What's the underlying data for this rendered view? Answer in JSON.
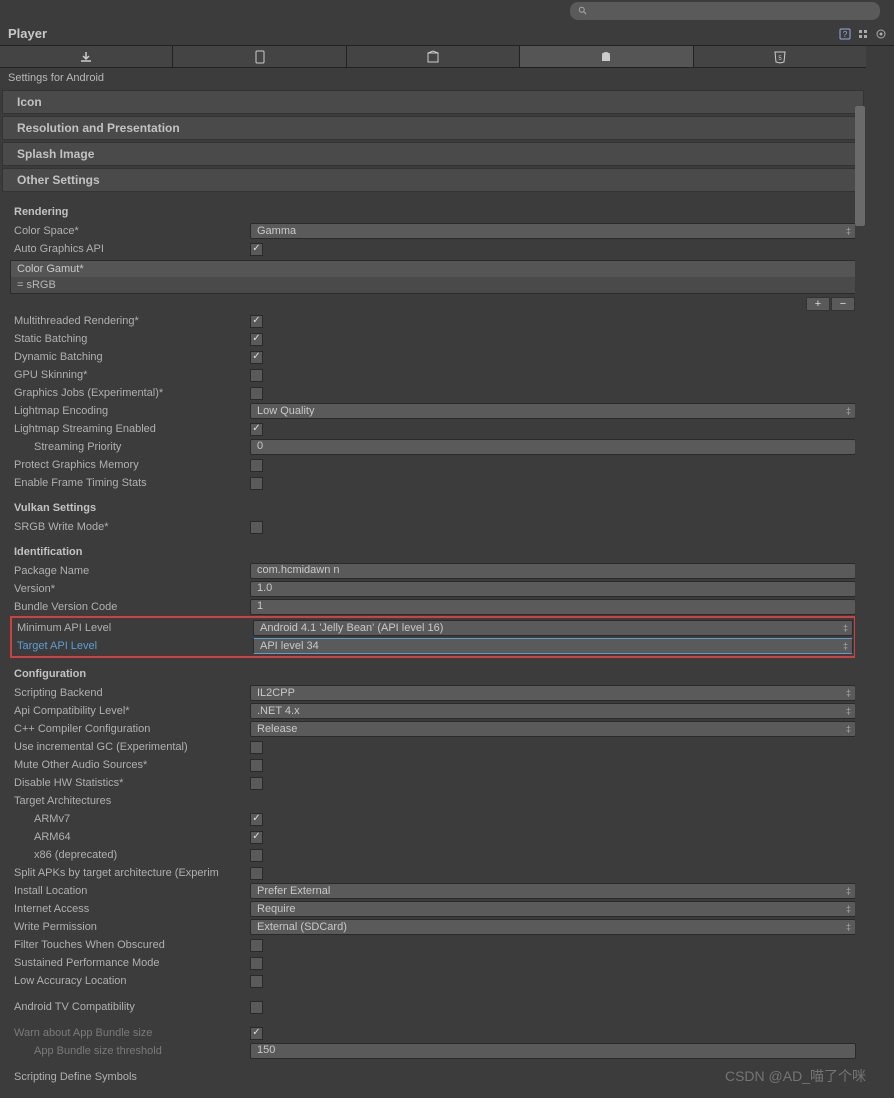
{
  "search": {
    "placeholder": ""
  },
  "header": {
    "title": "Player"
  },
  "tabs": [
    "download",
    "monitor",
    "default",
    "android",
    "html5"
  ],
  "section_title": "Settings for Android",
  "subs": {
    "icon": "Icon",
    "resolution": "Resolution and Presentation",
    "splash": "Splash Image",
    "other": "Other Settings"
  },
  "rendering": {
    "head": "Rendering",
    "color_space": {
      "label": "Color Space*",
      "value": "Gamma"
    },
    "auto_graphics": {
      "label": "Auto Graphics API",
      "checked": true
    },
    "color_gamut": {
      "label": "Color Gamut*",
      "item": "sRGB"
    },
    "multithread": {
      "label": "Multithreaded Rendering*",
      "checked": true
    },
    "static_batch": {
      "label": "Static Batching",
      "checked": true
    },
    "dynamic_batch": {
      "label": "Dynamic Batching",
      "checked": true
    },
    "gpu_skin": {
      "label": "GPU Skinning*",
      "checked": false
    },
    "graphics_jobs": {
      "label": "Graphics Jobs (Experimental)*",
      "checked": false
    },
    "lightmap_enc": {
      "label": "Lightmap Encoding",
      "value": "Low Quality"
    },
    "lightmap_stream": {
      "label": "Lightmap Streaming Enabled",
      "checked": true
    },
    "stream_prio": {
      "label": "Streaming Priority",
      "value": "0"
    },
    "protect_mem": {
      "label": "Protect Graphics Memory",
      "checked": false
    },
    "frame_timing": {
      "label": "Enable Frame Timing Stats",
      "checked": false
    }
  },
  "vulkan": {
    "head": "Vulkan Settings",
    "srgb_write": {
      "label": "SRGB Write Mode*",
      "checked": false
    }
  },
  "identification": {
    "head": "Identification",
    "package": {
      "label": "Package Name",
      "value": "com.hcmidawn      n"
    },
    "version": {
      "label": "Version*",
      "value": "1.0"
    },
    "bundle": {
      "label": "Bundle Version Code",
      "value": "1"
    },
    "min_api": {
      "label": "Minimum API Level",
      "value": "Android 4.1 'Jelly Bean' (API level 16)"
    },
    "target_api": {
      "label": "Target API Level",
      "value": "API level 34"
    }
  },
  "config": {
    "head": "Configuration",
    "backend": {
      "label": "Scripting Backend",
      "value": "IL2CPP"
    },
    "api_compat": {
      "label": "Api Compatibility Level*",
      "value": ".NET 4.x"
    },
    "cpp_conf": {
      "label": "C++ Compiler Configuration",
      "value": "Release"
    },
    "incr_gc": {
      "label": "Use incremental GC (Experimental)",
      "checked": false
    },
    "mute_audio": {
      "label": "Mute Other Audio Sources*",
      "checked": false
    },
    "disable_hw": {
      "label": "Disable HW Statistics*",
      "checked": false
    },
    "target_arch": {
      "label": "Target Architectures"
    },
    "armv7": {
      "label": "ARMv7",
      "checked": true
    },
    "arm64": {
      "label": "ARM64",
      "checked": true
    },
    "x86": {
      "label": "x86 (deprecated)",
      "checked": false
    },
    "split_apk": {
      "label": "Split APKs by target architecture (Experim",
      "checked": false
    },
    "install_loc": {
      "label": "Install Location",
      "value": "Prefer External"
    },
    "internet": {
      "label": "Internet Access",
      "value": "Require"
    },
    "write_perm": {
      "label": "Write Permission",
      "value": "External (SDCard)"
    },
    "filter_touch": {
      "label": "Filter Touches When Obscured",
      "checked": false
    },
    "sustained": {
      "label": "Sustained Performance Mode",
      "checked": false
    },
    "low_acc": {
      "label": "Low Accuracy Location",
      "checked": false
    },
    "tv_compat": {
      "label": "Android TV Compatibility",
      "checked": false
    },
    "warn_bundle": {
      "label": "Warn about App Bundle size",
      "checked": true
    },
    "bundle_thresh": {
      "label": "App Bundle size threshold",
      "value": "150"
    },
    "define_sym": {
      "label": "Scripting Define Symbols"
    }
  },
  "watermark": "CSDN @AD_喵了个咪"
}
